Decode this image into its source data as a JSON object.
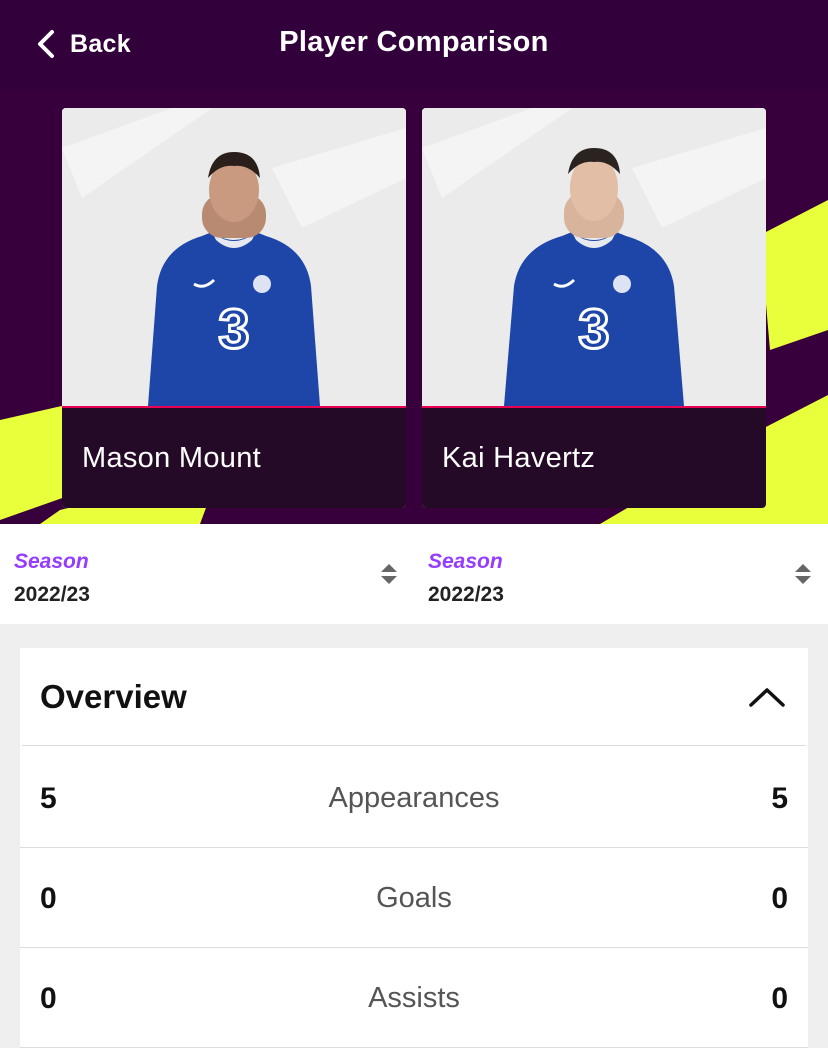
{
  "topbar": {
    "back_label": "Back",
    "title": "Player Comparison"
  },
  "players": [
    {
      "name": "Mason Mount"
    },
    {
      "name": "Kai Havertz"
    }
  ],
  "seasons": [
    {
      "label": "Season",
      "value": "2022/23"
    },
    {
      "label": "Season",
      "value": "2022/23"
    }
  ],
  "overview": {
    "title": "Overview",
    "rows": [
      {
        "label": "Appearances",
        "left": "5",
        "right": "5"
      },
      {
        "label": "Goals",
        "left": "0",
        "right": "0"
      },
      {
        "label": "Assists",
        "left": "0",
        "right": "0"
      }
    ]
  },
  "colors": {
    "brand_purple": "#37003c",
    "accent_lime": "#e8ff3c",
    "accent_pink": "#e90052",
    "season_label": "#963cff",
    "kit_blue": "#1a3fa3"
  },
  "icons": [
    "chevron-left-icon",
    "sort-arrows-icon",
    "chevron-up-icon"
  ]
}
